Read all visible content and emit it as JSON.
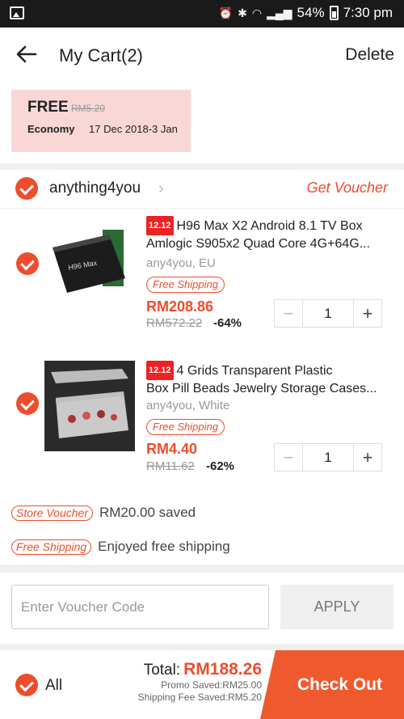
{
  "status_bar": {
    "battery": "54%",
    "time": "7:30 pm"
  },
  "header": {
    "title": "My Cart(2)",
    "delete_label": "Delete"
  },
  "shipping": {
    "price_label": "FREE",
    "original_fee": "RM5.20",
    "method": "Economy",
    "dates": "17 Dec 2018-3 Jan"
  },
  "shop": {
    "name": "anything4you",
    "voucher_link": "Get Voucher",
    "items": [
      {
        "promo_tag": "12.12",
        "name_line1": "H96 Max X2 Android 8.1 TV Box",
        "name_line2": "Amlogic S905x2 Quad Core 4G+64G...",
        "variant": "any4you, EU",
        "shipping_pill": "Free Shipping",
        "price": "RM208.86",
        "original_price": "RM572.22",
        "discount": "-64%",
        "quantity": "1",
        "image_label": "H96 Max"
      },
      {
        "promo_tag": "12.12",
        "name_line1": "4 Grids Transparent Plastic",
        "name_line2": "Box Pill Beads Jewelry Storage Cases...",
        "variant": "any4you, White",
        "shipping_pill": "Free Shipping",
        "price": "RM4.40",
        "original_price": "RM11.62",
        "discount": "-62%",
        "quantity": "1"
      }
    ],
    "store_voucher_tag": "Store Voucher",
    "store_voucher_text": "RM20.00 saved",
    "free_shipping_tag": "Free Shipping",
    "free_shipping_text": "Enjoyed free shipping"
  },
  "voucher": {
    "placeholder": "Enter Voucher Code",
    "apply_label": "APPLY"
  },
  "footer": {
    "all_label": "All",
    "total_label": "Total:",
    "total_amount": "RM188.26",
    "promo_saved": "Promo Saved:RM25.00",
    "shipping_saved": "Shipping Fee Saved:RM5.20",
    "checkout_label": "Check Out"
  },
  "colors": {
    "accent": "#ee4d2d",
    "shipping_card_bg": "#fad7d7"
  }
}
